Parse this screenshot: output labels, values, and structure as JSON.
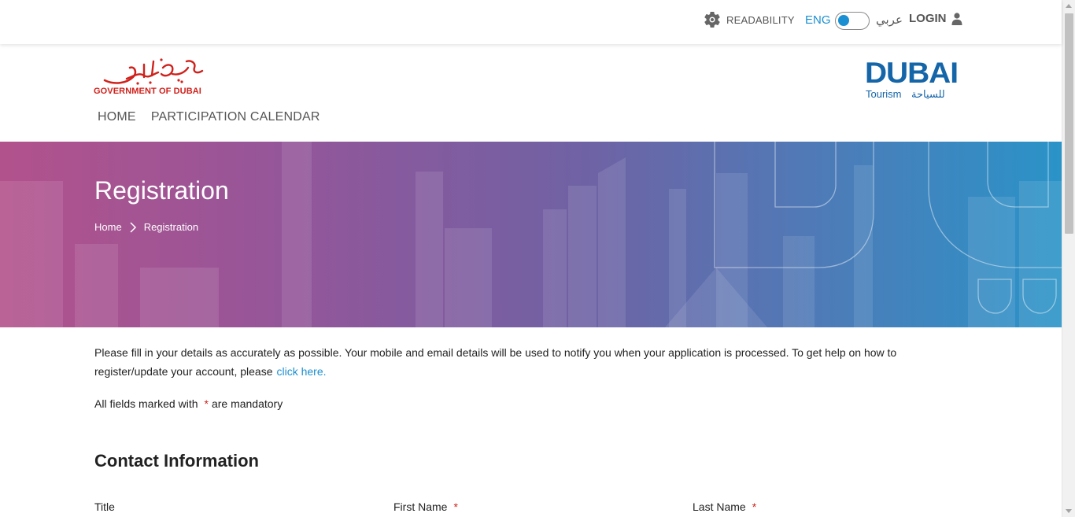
{
  "topbar": {
    "readability_label": "READABILITY",
    "lang_current": "ENG",
    "lang_other": "عربي",
    "login_label": "LOGIN"
  },
  "header": {
    "gov_logo_arabic": "حكومة دبي",
    "gov_logo_english": "GOVERNMENT OF DUBAI",
    "dubai_logo_text": "DUBAI",
    "dubai_logo_sub_en": "Tourism",
    "dubai_logo_sub_ar": "للسياحة",
    "nav": [
      {
        "label": "HOME"
      },
      {
        "label": "PARTICIPATION CALENDAR"
      }
    ]
  },
  "banner": {
    "title": "Registration",
    "breadcrumb": [
      {
        "label": "Home"
      },
      {
        "label": "Registration"
      }
    ]
  },
  "content": {
    "intro_text": "Please fill in your details as accurately as possible. Your mobile and email details will be used to notify you when your application is processed. To get help on how to register/update your account, please",
    "intro_link": "click here.",
    "mandatory_prefix": "All fields marked with",
    "mandatory_star": "*",
    "mandatory_suffix": "are mandatory",
    "section_title": "Contact Information",
    "fields": [
      {
        "label": "Title",
        "required": false
      },
      {
        "label": "First Name",
        "required": true,
        "star": "*"
      },
      {
        "label": "Last Name",
        "required": true,
        "star": "*"
      }
    ]
  },
  "colors": {
    "accent_blue": "#1a8fd1",
    "required_red": "#d0211b",
    "banner_start": "#b2528c",
    "banner_end": "#2a93c8",
    "dubai_logo_blue": "#1565a9"
  }
}
